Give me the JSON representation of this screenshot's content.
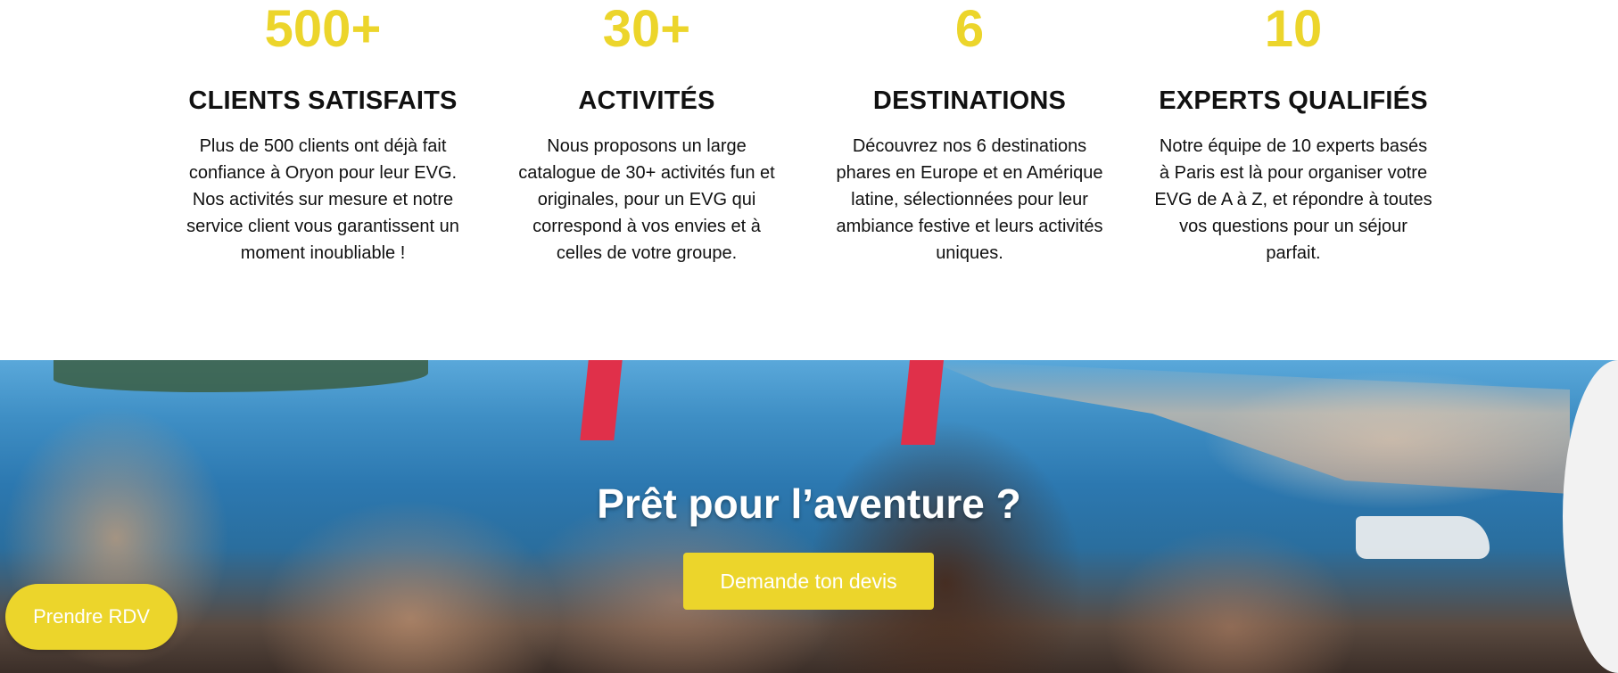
{
  "colors": {
    "accent": "#ecd52b",
    "text": "#111111",
    "background": "#ffffff"
  },
  "stats": [
    {
      "number": "500+",
      "title": "CLIENTS SATISFAITS",
      "text": "Plus de 500 clients ont déjà fait confiance à Oryon pour leur EVG. Nos activités sur mesure et notre service client vous garantissent un moment inoubliable !"
    },
    {
      "number": "30+",
      "title": "ACTIVITÉS",
      "text": "Nous proposons un large catalogue de 30+ activités fun et originales, pour un EVG qui correspond à vos envies et à celles de votre groupe."
    },
    {
      "number": "6",
      "title": "DESTINATIONS",
      "text": "Découvrez nos 6 destinations phares en Europe et en Amérique latine, sélectionnées pour leur ambiance festive et leurs activités uniques."
    },
    {
      "number": "10",
      "title": "EXPERTS QUALIFIÉS",
      "text": "Notre équipe de 10 experts basés à Paris est là pour organiser votre EVG de A à Z, et répondre à toutes vos questions pour un séjour parfait."
    }
  ],
  "hero": {
    "title": "Prêt pour l’aventure ?",
    "cta_label": "Demande ton devis"
  },
  "floating": {
    "rdv_label": "Prendre RDV"
  }
}
